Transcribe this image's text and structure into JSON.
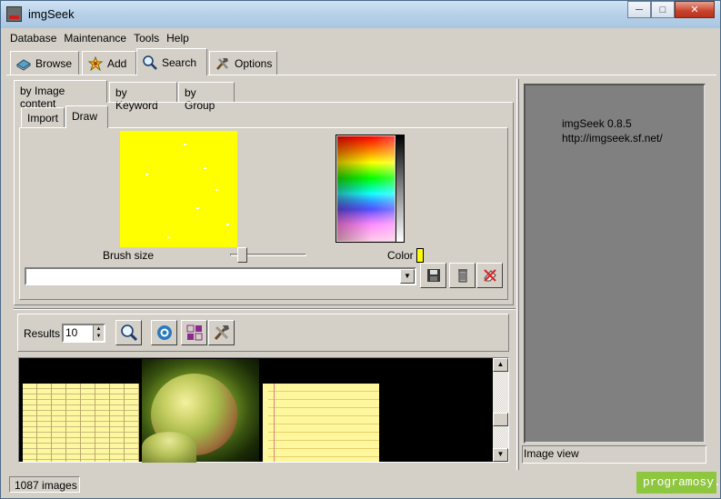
{
  "window": {
    "title": "imgSeek"
  },
  "menu": {
    "items": [
      "Database",
      "Maintenance",
      "Tools",
      "Help"
    ]
  },
  "main_tabs": [
    {
      "label": "Browse",
      "icon": "book-icon"
    },
    {
      "label": "Add",
      "icon": "add-star-icon"
    },
    {
      "label": "Search",
      "icon": "magnifier-icon",
      "active": true
    },
    {
      "label": "Options",
      "icon": "tools-icon"
    }
  ],
  "search_tabs": [
    "by Image content",
    "by Keyword",
    "by Group"
  ],
  "content_tabs": [
    "Import",
    "Draw"
  ],
  "draw": {
    "brush_label": "Brush size",
    "color_label": "Color",
    "selected_color": "#ffff00",
    "combo_value": ""
  },
  "results": {
    "label": "Results",
    "value": "10"
  },
  "image_view": {
    "line1": "imgSeek 0.8.5",
    "line2": "http://imgseek.sf.net/",
    "caption": "Image view"
  },
  "status": {
    "text": "1087 images"
  },
  "watermark": "programosy.pl",
  "thumbnails": [
    "ledger-sheet",
    "green-apples",
    "yellow-notepad"
  ]
}
